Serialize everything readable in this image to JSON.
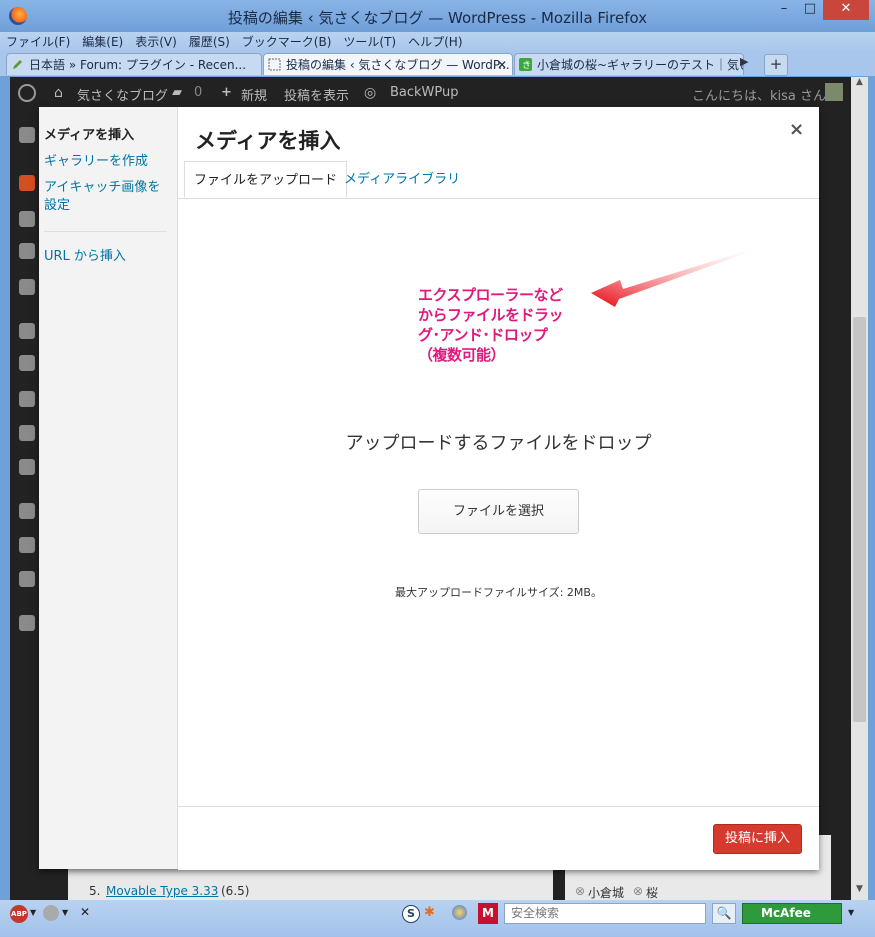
{
  "window": {
    "title": "投稿の編集 ‹ 気さくなブログ — WordPress - Mozilla Firefox",
    "minimize": "–",
    "maximize": "□",
    "close": "✕"
  },
  "menubar": [
    "ファイル(F)",
    "編集(E)",
    "表示(V)",
    "履歴(S)",
    "ブックマーク(B)",
    "ツール(T)",
    "ヘルプ(H)"
  ],
  "tabs": [
    {
      "label": "日本語 » Forum: プラグイン - Recen..."
    },
    {
      "label": "投稿の編集 ‹ 気さくなブログ — WordP...",
      "close": "✕"
    },
    {
      "label": "小倉城の桜~ギャラリーのテスト｜気さ..."
    }
  ],
  "tabs_extra": {
    "new_tab": "+",
    "scroll": "▶"
  },
  "adminbar": {
    "site_name": "気さくなブログ",
    "comments_count": "0",
    "new_label": "新規",
    "view_post": "投稿を表示",
    "backwpup": "BackWPup",
    "greeting": "こんにちは、kisa さん !"
  },
  "modal": {
    "title": "メディアを挿入",
    "close": "×",
    "menu": {
      "insert_media": "メディアを挿入",
      "create_gallery": "ギャラリーを作成",
      "set_featured": "アイキャッチ画像を設定",
      "insert_url": "URL から挿入"
    },
    "tabs": {
      "upload": "ファイルをアップロード",
      "library": "メディアライブラリ"
    },
    "drop_instructions": "アップロードするファイルをドロップ",
    "select_files": "ファイルを選択",
    "max_size": "最大アップロードファイルサイズ: 2MB。",
    "insert_button": "投稿に挿入"
  },
  "annotation": {
    "text": "エクスプローラーなどからファイルをドラッグ･アンド･ドロップ（複数可能）",
    "color": "#e0197d"
  },
  "background": {
    "list_item_5": "5.",
    "list_item_5_link": "Movable Type 3.33",
    "list_item_5_count": "(6.5)",
    "tag_1": "小倉城",
    "tag_2": "桜"
  },
  "statusbar": {
    "search_placeholder": "安全検索",
    "mcafee": "McAfee",
    "abp": "ABP"
  },
  "colors": {
    "accent": "#0074a2",
    "primary_button": "#d63a2e",
    "adminbar": "#222222"
  }
}
